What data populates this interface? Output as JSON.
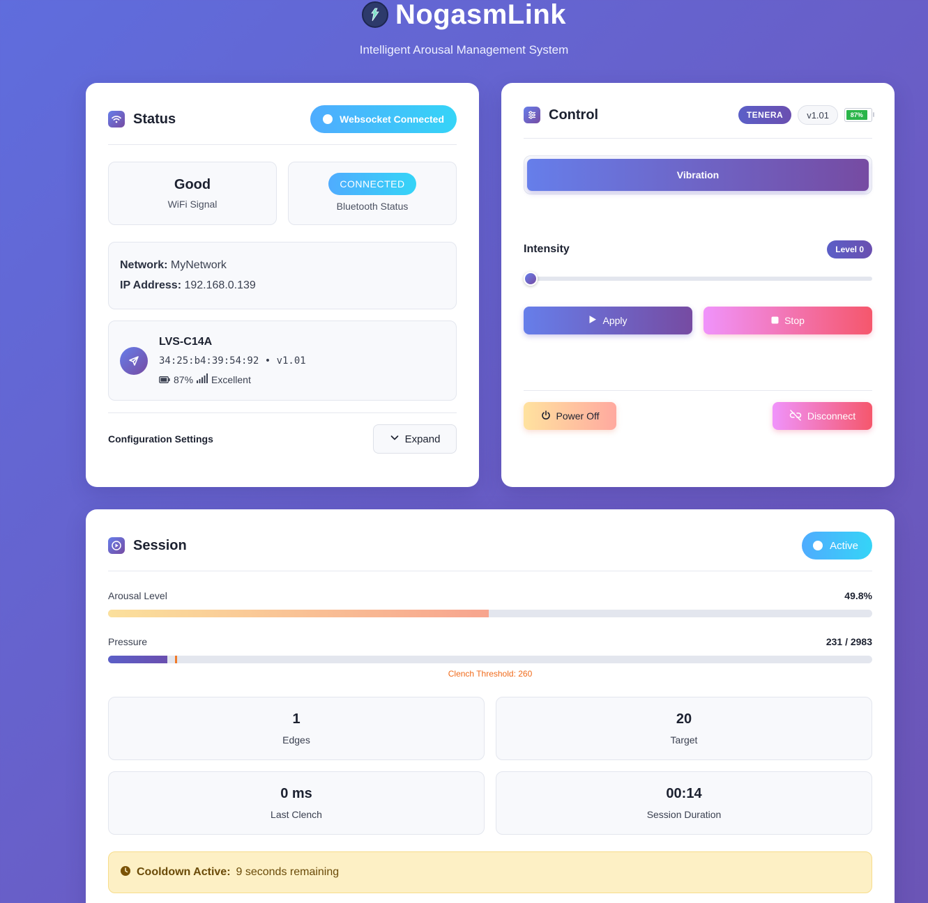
{
  "app": {
    "title": "NogasmLink",
    "subtitle": "Intelligent Arousal Management System"
  },
  "status": {
    "title": "Status",
    "websocket_label": "Websocket Connected",
    "wifi_value": "Good",
    "wifi_label": "WiFi Signal",
    "bluetooth_value": "CONNECTED",
    "bluetooth_label": "Bluetooth Status",
    "network_label": "Network:",
    "network_value": "MyNetwork",
    "ip_label": "IP Address:",
    "ip_value": "192.168.0.139",
    "device": {
      "name": "LVS-C14A",
      "mac_version": "34:25:b4:39:54:92 • v1.01",
      "battery": "87%",
      "signal": "Excellent"
    },
    "config_label": "Configuration Settings",
    "expand_label": "Expand"
  },
  "control": {
    "title": "Control",
    "model_badge": "TENERA",
    "version_badge": "v1.01",
    "battery_badge": "87%",
    "battery_fraction": 0.87,
    "mode_label": "Vibration",
    "intensity_label": "Intensity",
    "level_badge": "Level 0",
    "intensity_value": 0,
    "apply_label": "Apply",
    "stop_label": "Stop",
    "power_off_label": "Power Off",
    "disconnect_label": "Disconnect"
  },
  "session": {
    "title": "Session",
    "active_label": "Active",
    "arousal_label": "Arousal Level",
    "arousal_value": "49.8%",
    "arousal_fraction": 0.498,
    "pressure_label": "Pressure",
    "pressure_value": "231 / 2983",
    "pressure_current": 231,
    "pressure_max": 2983,
    "threshold_value": 260,
    "threshold_text": "Clench Threshold: 260",
    "stats": [
      {
        "value": "1",
        "label": "Edges"
      },
      {
        "value": "20",
        "label": "Target"
      },
      {
        "value": "0 ms",
        "label": "Last Clench"
      },
      {
        "value": "00:14",
        "label": "Session Duration"
      }
    ],
    "cooldown_label": "Cooldown Active:",
    "cooldown_text": "9 seconds remaining"
  },
  "colors": {
    "accent": "#667eea",
    "accent_dark": "#764ba2",
    "cyan": "#4facfe",
    "pink": "#f5576c",
    "warning_bg": "#fdf0c5"
  }
}
